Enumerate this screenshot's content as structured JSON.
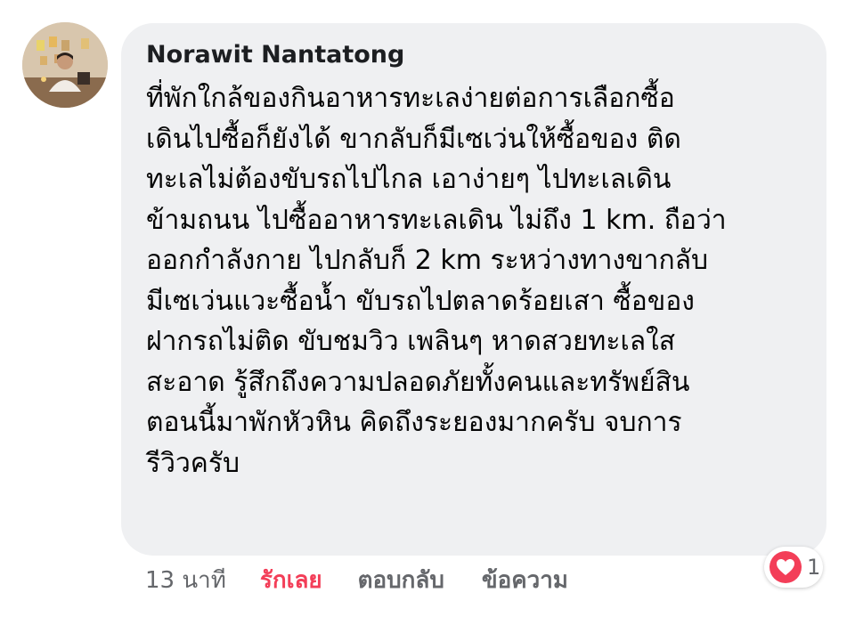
{
  "comment": {
    "author": "Norawit Nantatong",
    "lines": [
      "ที่พักใกล้ของกินอาหารทะเลง่ายต่อการเลือกซื้อ",
      "เดินไปซื้อก็ยังได้ ขากลับก็มีเซเว่นให้ซื้อของ ติด",
      "ทะเลไม่ต้องขับรถไปไกล เอาง่ายๆ ไปทะเลเดิน",
      "ข้ามถนน ไปซื้ออาหารทะเลเดิน ไม่ถึง 1 km. ถือว่า",
      "ออกกำลังกาย ไปกลับก็ 2 km ระหว่างทางขากลับ",
      "มีเซเว่นแวะซื้อน้ำ ขับรถไปตลาดร้อยเสา ซื้อของ",
      "ฝากรถไม่ติด ขับชมวิว เพลินๆ หาดสวยทะเลใส",
      "สะอาด รู้สึกถึงความปลอดภัยทั้งคนและทรัพย์สิน",
      "ตอนนี้มาพักหัวหิน คิดถึงระยองมากครับ  จบการ",
      "รีวิวครับ"
    ]
  },
  "actions": {
    "time": "13 นาที",
    "love": "รักเลย",
    "reply": "ตอบกลับ",
    "message": "ข้อความ"
  },
  "reaction": {
    "icon": "heart-icon",
    "count": "1",
    "color": "#f33e58"
  },
  "colors": {
    "bubble": "#eff0f2",
    "text": "#050505",
    "muted": "#65676b",
    "love": "#f33e58"
  }
}
